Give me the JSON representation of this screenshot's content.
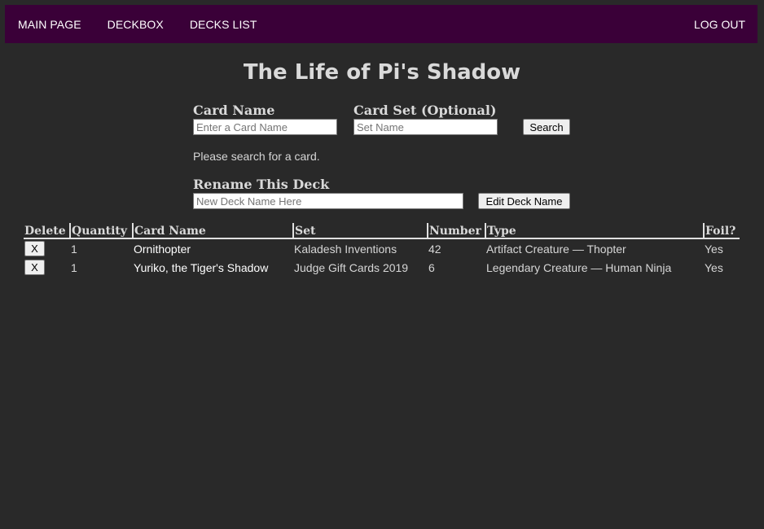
{
  "nav": {
    "main_page": "MAIN PAGE",
    "deckbox": "DECKBOX",
    "decks_list": "DECKS LIST",
    "log_out": "LOG OUT"
  },
  "deck_title": "The Life of Pi's Shadow",
  "search": {
    "card_name_label": "Card Name",
    "card_name_placeholder": "Enter a Card Name",
    "card_set_label": "Card Set (Optional)",
    "card_set_placeholder": "Set Name",
    "search_button": "Search",
    "status": "Please search for a card."
  },
  "rename": {
    "label": "Rename This Deck",
    "placeholder": "New Deck Name Here",
    "button": "Edit Deck Name"
  },
  "table": {
    "headers": [
      "Delete",
      "Quantity",
      "Card Name",
      "Set",
      "Number",
      "Type",
      "Foil?"
    ],
    "rows": [
      {
        "delete": "X",
        "quantity": "1",
        "card_name": "Ornithopter",
        "set": "Kaladesh Inventions",
        "number": "42",
        "type": "Artifact Creature — Thopter",
        "foil": "Yes"
      },
      {
        "delete": "X",
        "quantity": "1",
        "card_name": "Yuriko, the Tiger's Shadow",
        "set": "Judge Gift Cards 2019",
        "number": "6",
        "type": "Legendary Creature — Human Ninja",
        "foil": "Yes"
      }
    ]
  },
  "colors": {
    "background": "#292929",
    "navbar": "#3a0038",
    "text": "#d6d6d6"
  }
}
